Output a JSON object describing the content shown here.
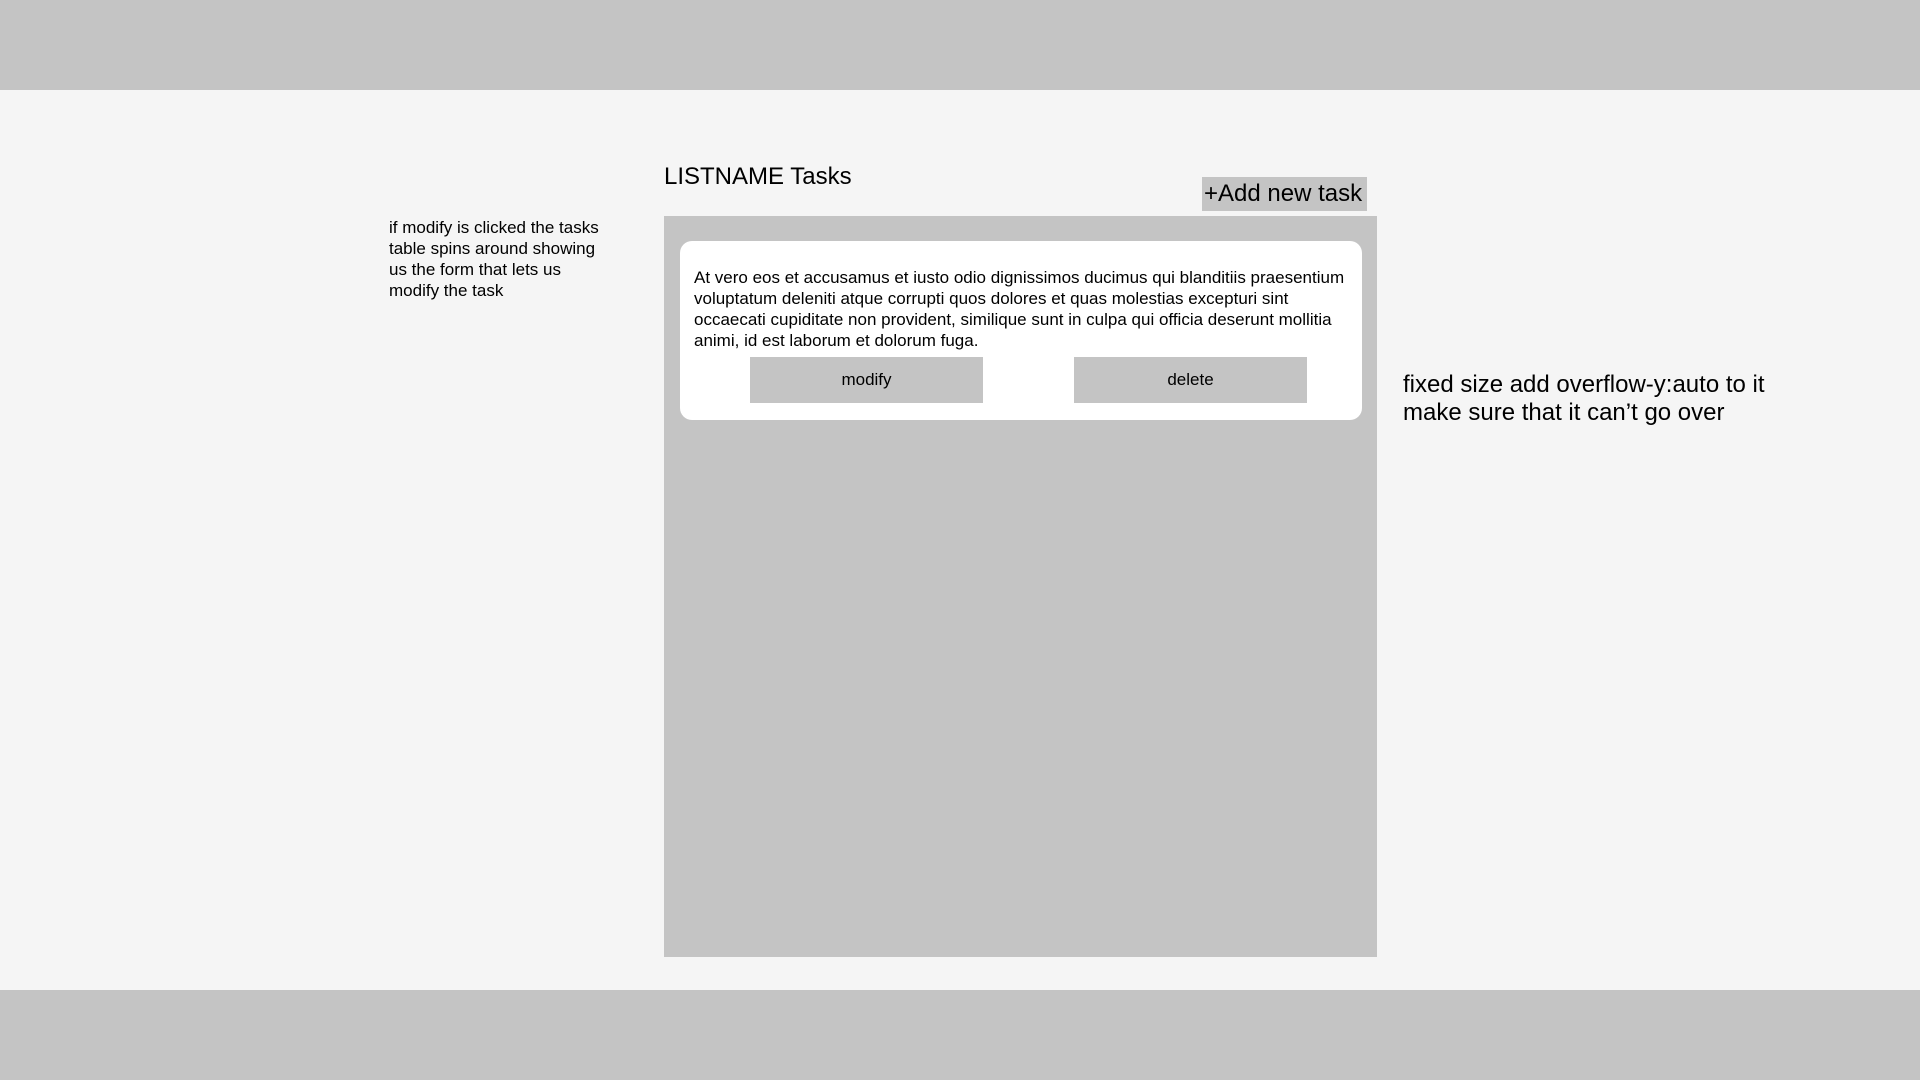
{
  "notes": {
    "left": "if modify is clicked the tasks table spins around showing us the form that lets us modify the task",
    "right": "fixed size add overflow-y:auto to it make sure that it can’t go over"
  },
  "list": {
    "title": "LISTNAME Tasks",
    "add_button_label": "+Add new task"
  },
  "tasks": [
    {
      "text": "At vero eos et accusamus et iusto odio dignissimos ducimus qui blanditiis praesentium voluptatum deleniti atque corrupti quos dolores et quas molestias excepturi sint occaecati cupiditate non provident, similique sunt in culpa qui officia deserunt mollitia animi, id est laborum et dolorum fuga.",
      "modify_label": "modify",
      "delete_label": "delete"
    }
  ],
  "colors": {
    "background": "#f5f5f5",
    "bars": "#c4c4c4",
    "card": "#ffffff"
  }
}
